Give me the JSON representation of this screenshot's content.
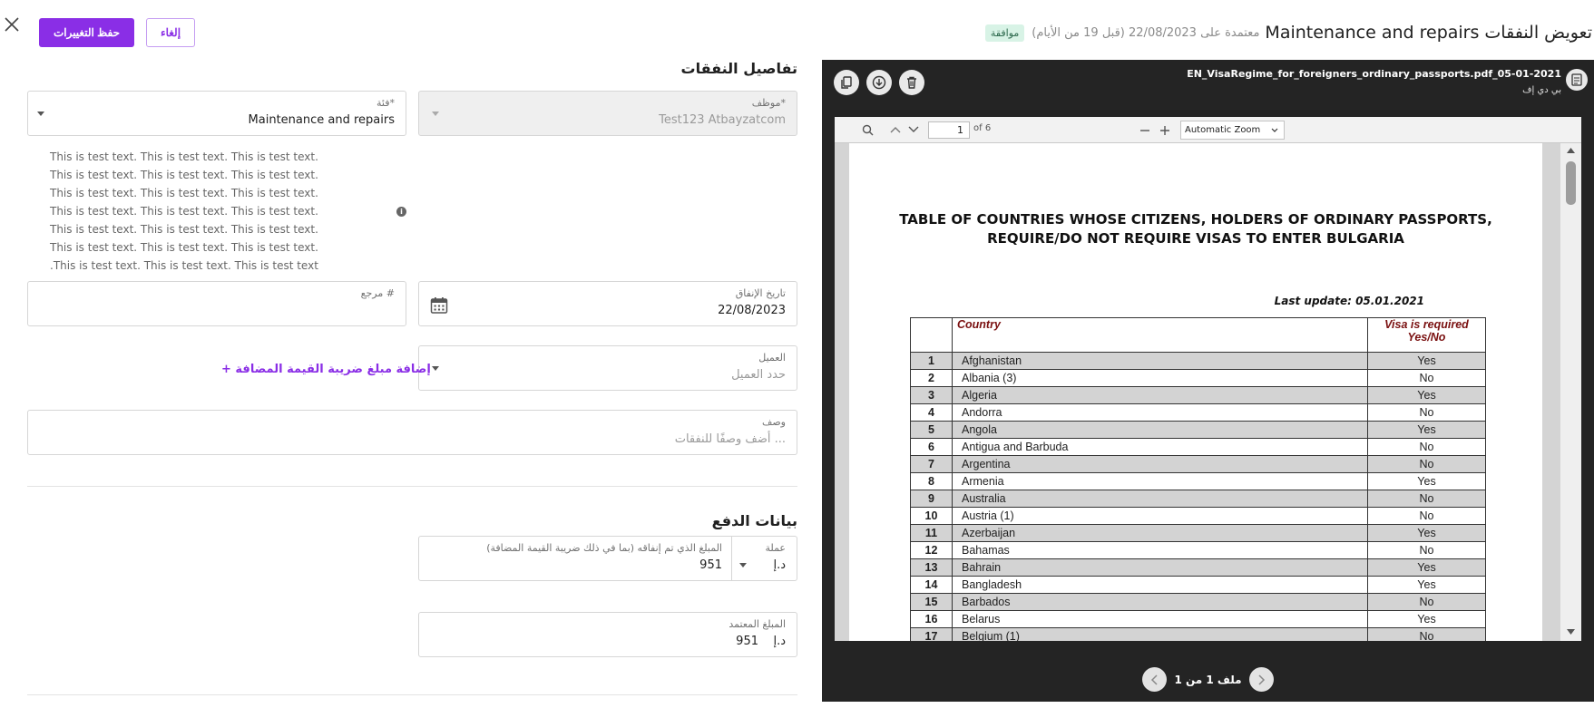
{
  "header": {
    "title": "Maintenance and repairs تعويض النفقات",
    "approved_text": "معتمدة على 22/08/2023 (قبل 19 من الأيام)",
    "status_badge": "موافقة",
    "save_label": "حفظ التغييرات",
    "cancel_label": "إلغاء"
  },
  "expense_details": {
    "section_title": "تفاصيل النفقات",
    "employee": {
      "label": "موظف*",
      "value": "Test123 Atbayzatcom"
    },
    "category": {
      "label": "فئة*",
      "value": "Maintenance and repairs"
    },
    "hint_lines": [
      "This is test text. This is test text. This is test text.",
      "This is test text. This is test text. This is test text.",
      "This is test text. This is test text. This is test text.",
      "This is test text. This is test text. This is test text.",
      "This is test text. This is test text. This is test text.",
      "This is test text. This is test text. This is test text.",
      ".This is test text. This is test text. This is test text"
    ],
    "expense_date": {
      "label": "تاريخ الإنفاق",
      "value": "22/08/2023"
    },
    "reference": {
      "label": "مرجع #"
    },
    "customer": {
      "label": "العميل",
      "placeholder": "حدد العميل"
    },
    "add_vat_link": "+ إضافة مبلغ ضريبة القيمة المضافة",
    "description": {
      "label": "وصف",
      "placeholder": "أضف وصفًا للنفقات ..."
    }
  },
  "payment": {
    "section_title": "بيانات الدفع",
    "currency": {
      "label": "عملة",
      "value": "د.إ"
    },
    "amount_spent": {
      "label": "المبلغ الذي تم إنفاقه (بما في ذلك ضريبة القيمة المضافة)",
      "value": "951"
    },
    "approved_amount": {
      "label": "المبلغ المعتمد",
      "currency": "د.إ",
      "value": "951"
    }
  },
  "viewer": {
    "file_name": "EN_VisaRegime_for_foreigners_ordinary_passports.pdf_05-01-2021",
    "file_type": "بي دي إف",
    "toolbar": {
      "page_number": "1",
      "page_count": "of 6",
      "zoom": "Automatic Zoom"
    },
    "pager_text": "ملف 1 من 1",
    "pdf": {
      "heading_line1": "TABLE OF COUNTRIES WHOSE CITIZENS, HOLDERS OF ORDINARY PASSPORTS,",
      "heading_line2": "REQUIRE/DO NOT REQUIRE VISAS TO ENTER BULGARIA",
      "last_update": "Last update: 05.01.2021",
      "col_country": "Country",
      "col_visa": "Visa is required Yes/No",
      "rows": [
        {
          "num": "1",
          "country": "Afghanistan",
          "visa": "Yes"
        },
        {
          "num": "2",
          "country": "Albania (3)",
          "visa": "No"
        },
        {
          "num": "3",
          "country": "Algeria",
          "visa": "Yes"
        },
        {
          "num": "4",
          "country": "Andorra",
          "visa": "No"
        },
        {
          "num": "5",
          "country": "Angola",
          "visa": "Yes"
        },
        {
          "num": "6",
          "country": "Antigua and Barbuda",
          "visa": "No"
        },
        {
          "num": "7",
          "country": "Argentina",
          "visa": "No"
        },
        {
          "num": "8",
          "country": "Armenia",
          "visa": "Yes"
        },
        {
          "num": "9",
          "country": "Australia",
          "visa": "No"
        },
        {
          "num": "10",
          "country": "Austria (1)",
          "visa": "No"
        },
        {
          "num": "11",
          "country": "Azerbaijan",
          "visa": "Yes"
        },
        {
          "num": "12",
          "country": "Bahamas",
          "visa": "No"
        },
        {
          "num": "13",
          "country": "Bahrain",
          "visa": "Yes"
        },
        {
          "num": "14",
          "country": "Bangladesh",
          "visa": "Yes"
        },
        {
          "num": "15",
          "country": "Barbados",
          "visa": "No"
        },
        {
          "num": "16",
          "country": "Belarus",
          "visa": "Yes"
        },
        {
          "num": "17",
          "country": "Belgium (1)",
          "visa": "No"
        }
      ]
    }
  },
  "icons": {
    "close": "close-icon",
    "calendar": "calendar-icon",
    "info": "info-icon",
    "trash": "trash-icon",
    "download": "download-icon",
    "copy": "copy-icon",
    "file": "file-icon"
  },
  "colors": {
    "accent": "#8a2ee6",
    "badge_bg": "#d8f3e6",
    "viewer_bg": "#242424"
  }
}
